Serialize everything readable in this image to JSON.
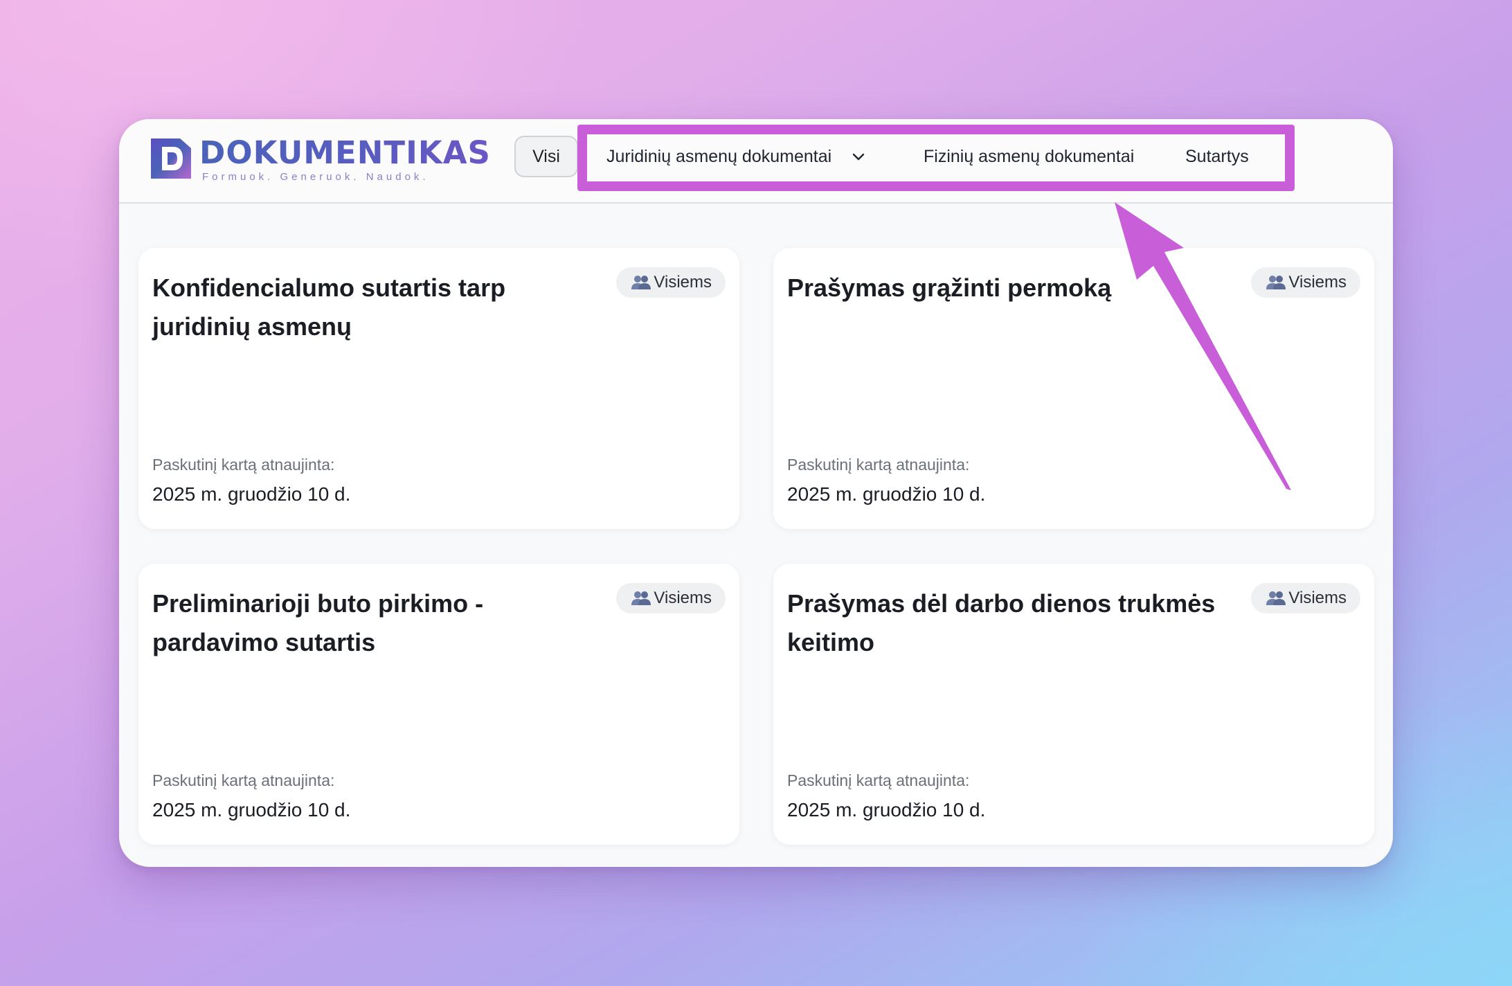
{
  "brand": {
    "name": "DOKUMENTIKAS",
    "tagline": "Formuok. Generuok. Naudok.",
    "colors": {
      "primary": "#4a63b8",
      "accent": "#6b56c4"
    }
  },
  "nav": {
    "filter_all": "Visi",
    "items": [
      {
        "label": "Juridinių asmenų dokumentai",
        "has_dropdown": true
      },
      {
        "label": "Fizinių asmenų dokumentai",
        "has_dropdown": false
      },
      {
        "label": "Sutartys",
        "has_dropdown": false
      }
    ],
    "highlight_color": "#c85fd8"
  },
  "cards": [
    {
      "title": "Konfidencialumo sutartis tarp juridinių asmenų",
      "badge": "Visiems",
      "badge_icon": "people-icon",
      "updated_label": "Paskutinį kartą atnaujinta:",
      "updated_date": "2025 m. gruodžio 10 d."
    },
    {
      "title": "Prašymas grąžinti permoką",
      "badge": "Visiems",
      "badge_icon": "people-icon",
      "updated_label": "Paskutinį kartą atnaujinta:",
      "updated_date": "2025 m. gruodžio 10 d."
    },
    {
      "title": "Preliminarioji buto pirkimo - pardavimo sutartis",
      "badge": "Visiems",
      "badge_icon": "people-icon",
      "updated_label": "Paskutinį kartą atnaujinta:",
      "updated_date": "2025 m. gruodžio 10 d."
    },
    {
      "title": "Prašymas dėl darbo dienos trukmės keitimo",
      "badge": "Visiems",
      "badge_icon": "people-icon",
      "updated_label": "Paskutinį kartą atnaujinta:",
      "updated_date": "2025 m. gruodžio 10 d."
    }
  ],
  "annotation": {
    "type": "arrow",
    "color": "#c85fd8"
  }
}
